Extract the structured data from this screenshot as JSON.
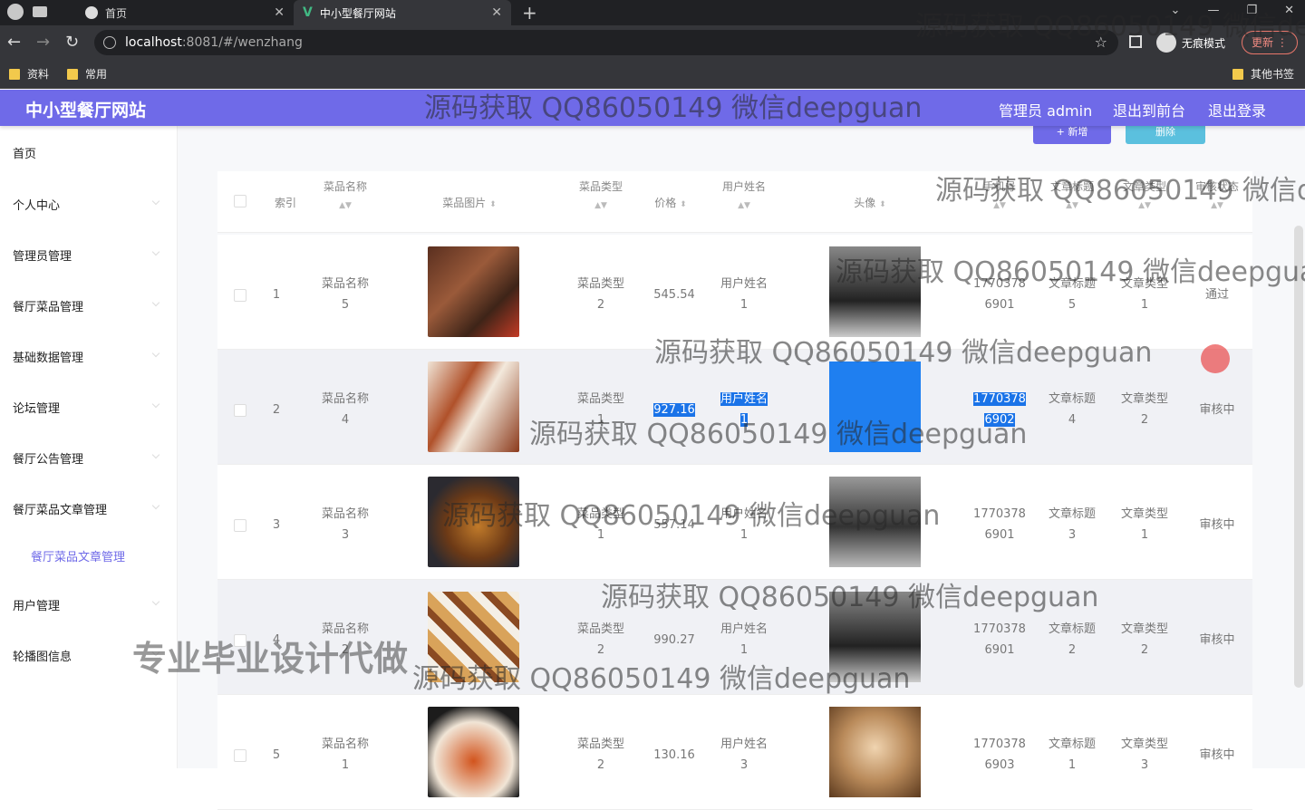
{
  "browser": {
    "tabs": [
      {
        "title": "首页"
      },
      {
        "title": "中小型餐厅网站"
      }
    ],
    "url_host": "localhost",
    "url_port_path": ":8081/#/wenzhang",
    "incognito_label": "无痕模式",
    "update_label": "更新",
    "bookmarks": [
      "资料",
      "常用"
    ],
    "other_bookmarks": "其他书签"
  },
  "header": {
    "brand": "中小型餐厅网站",
    "admin": "管理员 admin",
    "back_front": "退出到前台",
    "logout": "退出登录"
  },
  "sidebar": {
    "items": [
      "首页",
      "个人中心",
      "管理员管理",
      "餐厅菜品管理",
      "基础数据管理",
      "论坛管理",
      "餐厅公告管理",
      "餐厅菜品文章管理"
    ],
    "sub_item": "餐厅菜品文章管理",
    "items_after": [
      "用户管理",
      "轮播图信息"
    ]
  },
  "toolbar": {
    "add_label": "+ 新增",
    "delete_label": "删除"
  },
  "table": {
    "headers": {
      "index": "索引",
      "dish_name": "菜品名称",
      "dish_image": "菜品图片",
      "dish_type": "菜品类型",
      "price": "价格",
      "user_name": "用户姓名",
      "avatar": "头像",
      "phone": "手机号",
      "article_title": "文章标题",
      "article_type": "文章类型",
      "status": "审核状态"
    },
    "rows": [
      {
        "index": "1",
        "dish_name_a": "菜品名称",
        "dish_name_b": "5",
        "dish_type_a": "菜品类型",
        "dish_type_b": "2",
        "price": "545.54",
        "user_a": "用户姓名",
        "user_b": "1",
        "phone_a": "1770378",
        "phone_b": "6901",
        "title_a": "文章标题",
        "title_b": "5",
        "type_a": "文章类型",
        "type_b": "1",
        "status": "通过"
      },
      {
        "index": "2",
        "dish_name_a": "菜品名称",
        "dish_name_b": "4",
        "dish_type_a": "菜品类型",
        "dish_type_b": "1",
        "price": "927.16",
        "user_a": "用户姓名",
        "user_b": "1",
        "phone_a": "1770378",
        "phone_b": "6902",
        "title_a": "文章标题",
        "title_b": "4",
        "type_a": "文章类型",
        "type_b": "2",
        "status": "审核中"
      },
      {
        "index": "3",
        "dish_name_a": "菜品名称",
        "dish_name_b": "3",
        "dish_type_a": "菜品类型",
        "dish_type_b": "1",
        "price": "557.14",
        "user_a": "用户姓名",
        "user_b": "1",
        "phone_a": "1770378",
        "phone_b": "6901",
        "title_a": "文章标题",
        "title_b": "3",
        "type_a": "文章类型",
        "type_b": "1",
        "status": "审核中"
      },
      {
        "index": "4",
        "dish_name_a": "菜品名称",
        "dish_name_b": "2",
        "dish_type_a": "菜品类型",
        "dish_type_b": "2",
        "price": "990.27",
        "user_a": "用户姓名",
        "user_b": "1",
        "phone_a": "1770378",
        "phone_b": "6901",
        "title_a": "文章标题",
        "title_b": "2",
        "type_a": "文章类型",
        "type_b": "2",
        "status": "审核中"
      },
      {
        "index": "5",
        "dish_name_a": "菜品名称",
        "dish_name_b": "1",
        "dish_type_a": "菜品类型",
        "dish_type_b": "2",
        "price": "130.16",
        "user_a": "用户姓名",
        "user_b": "3",
        "phone_a": "1770378",
        "phone_b": "6903",
        "title_a": "文章标题",
        "title_b": "1",
        "type_a": "文章类型",
        "type_b": "3",
        "status": "审核中"
      }
    ]
  },
  "watermarks": {
    "qq": "源码获取 QQ86050149 微信deepguan",
    "big": "专业毕业设计代做"
  },
  "colors": {
    "brand": "#6f6ae8",
    "delete": "#5bc0de",
    "selection": "#1a73e8"
  }
}
